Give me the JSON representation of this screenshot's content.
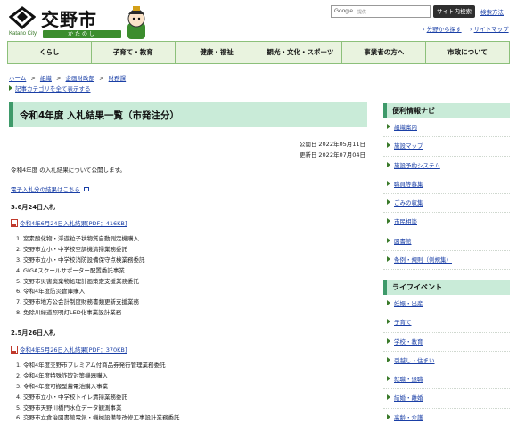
{
  "header": {
    "logo_name": "交野市",
    "logo_en": "Katano City",
    "logo_kana": "かたのし",
    "search_google_label": "Google",
    "search_google_sub": "提供",
    "search_button": "サイト内検索",
    "search_help": "検索方法",
    "link_site_nav": "分野から探す",
    "link_sitemap": "サイトマップ"
  },
  "gnav": [
    "くらし",
    "子育て・教育",
    "健康・福祉",
    "観光・文化・スポーツ",
    "事業者の方へ",
    "市政について"
  ],
  "breadcrumb": {
    "items": [
      "ホーム",
      "組織",
      "企画財政部",
      "財務課"
    ],
    "separator": ">",
    "show_all": "記事カテゴリを全て表示する"
  },
  "main": {
    "title": "令和4年度 入札結果一覧（市発注分）",
    "published": "公開日 2022年05月11日",
    "updated": "更新日 2022年07月04日",
    "intro": "令和4年度 の入札結果について公開します。",
    "electronic_link": "電子入札分の結果はこちら",
    "sections": [
      {
        "heading": "3.6月24日入札",
        "pdf": "令和4年6月24日入札結果[PDF：416KB]",
        "items": [
          "窒素酸化物・浮遊粒子状物質自動測定機購入",
          "交野市立小・中学校空調機清掃業務委託",
          "交野市立小・中学校消防設備保守点検業務委託",
          "GIGAスクールサポーター配置委託事業",
          "交野市災害廃棄物処理計画策定支援業務委託",
          "令和4年度防災倉庫購入",
          "交野市地方公会計制度財務書類更新支援業務",
          "免除川緑道照明灯LED化事業設計業務"
        ]
      },
      {
        "heading": "2.5月26日入札",
        "pdf": "令和4年5月26日入札結果[PDF：370KB]",
        "items": [
          "令和4年度交野市プレミアム付商品券発行管理業務委託",
          "令和4年度特殊詐欺対策機器購入",
          "令和4年度可搬型蓄電池購入事業",
          "交野市立小・中学校トイレ清掃業務委託",
          "交野市天野川橋門水位データ観測事業",
          "交野市立倉治図書館電気・機械設備等改修工事設計業務委託"
        ]
      }
    ]
  },
  "sidebar": {
    "nav_title": "便利情報ナビ",
    "nav_items": [
      "組織案内",
      "施設マップ",
      "施設予約システム",
      "職員等募集",
      "ごみの収集",
      "市民相談",
      "図書館",
      "条例・規則（例規集）"
    ],
    "life_title": "ライフイベント",
    "life_items": [
      "妊娠・出産",
      "子育て",
      "学校・教育",
      "引越し・住まい",
      "就職・退職",
      "結婚・離婚",
      "高齢・介護"
    ]
  },
  "colors": {
    "accent_green": "#3e9a6a",
    "title_bg": "#c9ebd8",
    "nav_bg": "#e9f3df",
    "link": "#1a3fa6"
  }
}
